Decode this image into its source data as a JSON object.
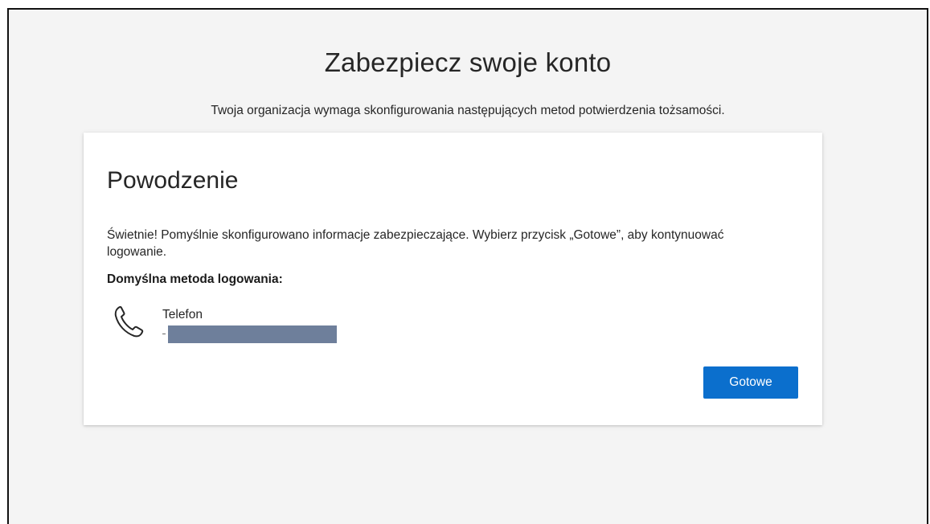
{
  "page": {
    "title": "Zabezpiecz swoje konto",
    "subtitle": "Twoja organizacja wymaga skonfigurowania następujących metod potwierdzenia tożsamości."
  },
  "card": {
    "title": "Powodzenie",
    "message": "Świetnie! Pomyślnie skonfigurowano informacje zabezpieczające. Wybierz przycisk „Gotowe”, aby kontynuować logowanie.",
    "default_method_label": "Domyślna metoda logowania:",
    "method": {
      "icon": "phone-icon",
      "name": "Telefon",
      "value_redacted": true
    },
    "done_label": "Gotowe"
  },
  "colors": {
    "background": "#f4f4f4",
    "card": "#ffffff",
    "accent": "#0b6fcd",
    "redaction": "#6e7f9b"
  }
}
